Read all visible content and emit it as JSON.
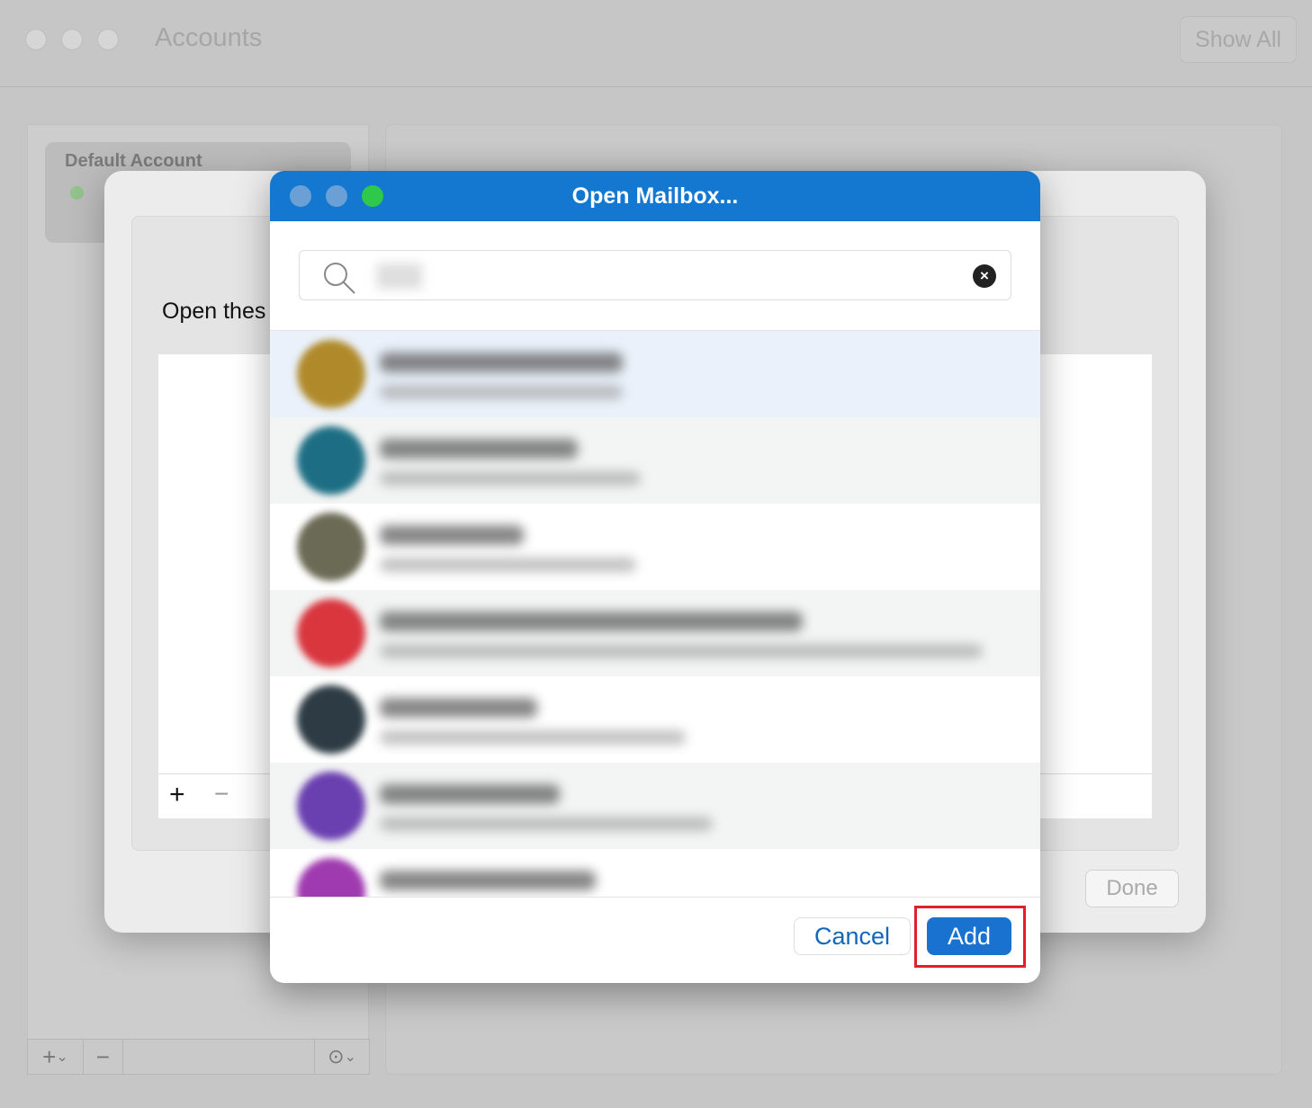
{
  "window": {
    "title": "Accounts",
    "show_all": "Show All"
  },
  "sidebar": {
    "default_account_label": "Default Account",
    "status_color": "#93c28d"
  },
  "sheet": {
    "prompt": "Open thes",
    "done": "Done",
    "add_icon": "plus-icon",
    "remove_icon": "minus-icon"
  },
  "dialog": {
    "title": "Open Mailbox...",
    "accent": "#1478d0",
    "search_icon": "search-icon",
    "clear_icon": "clear-icon",
    "results": [
      {
        "avatar_color": "#b08a2a",
        "selected": true
      },
      {
        "avatar_color": "#1d6e84"
      },
      {
        "avatar_color": "#6b6a55"
      },
      {
        "avatar_color": "#d9363e"
      },
      {
        "avatar_color": "#2d3c44"
      },
      {
        "avatar_color": "#6a3fb0"
      },
      {
        "avatar_color": "#a03ab0"
      }
    ],
    "cancel": "Cancel",
    "add": "Add",
    "highlight_color": "#e0202a"
  }
}
